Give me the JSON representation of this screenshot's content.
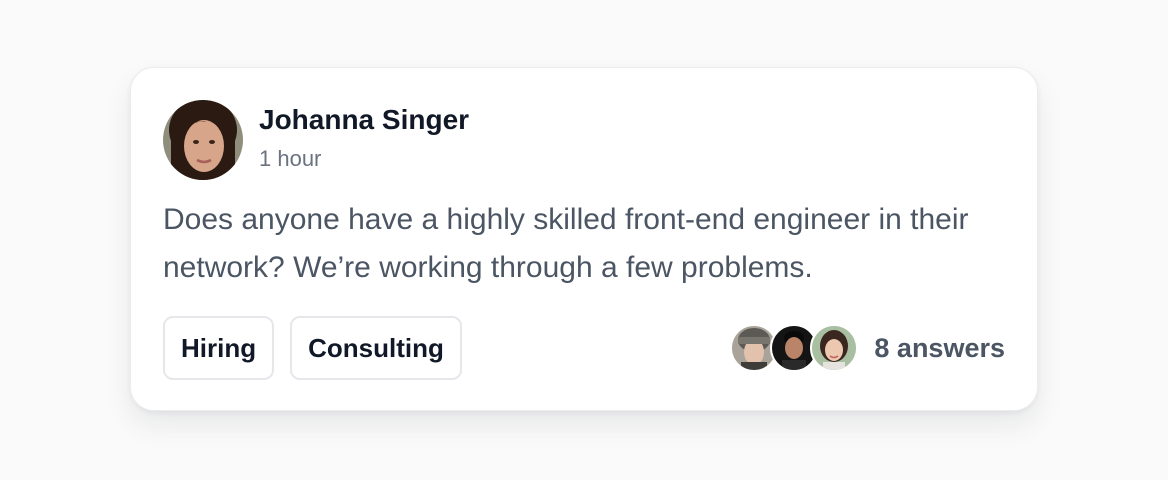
{
  "post": {
    "author": {
      "name": "Johanna Singer",
      "time": "1 hour",
      "avatar_icon": "user-avatar-photo"
    },
    "body": "Does anyone have a highly skilled front-end engineer in their network? We’re working through a few problems.",
    "tags": [
      {
        "label": "Hiring"
      },
      {
        "label": "Consulting"
      }
    ],
    "answers": {
      "label": "8 answers",
      "avatar_icons": [
        "responder-avatar-1",
        "responder-avatar-2",
        "responder-avatar-3"
      ]
    }
  },
  "colors": {
    "background": "#fafafa",
    "card": "#ffffff",
    "border": "#e5e7eb",
    "heading": "#111827",
    "body_text": "#4b5563",
    "muted_text": "#6b7280"
  }
}
